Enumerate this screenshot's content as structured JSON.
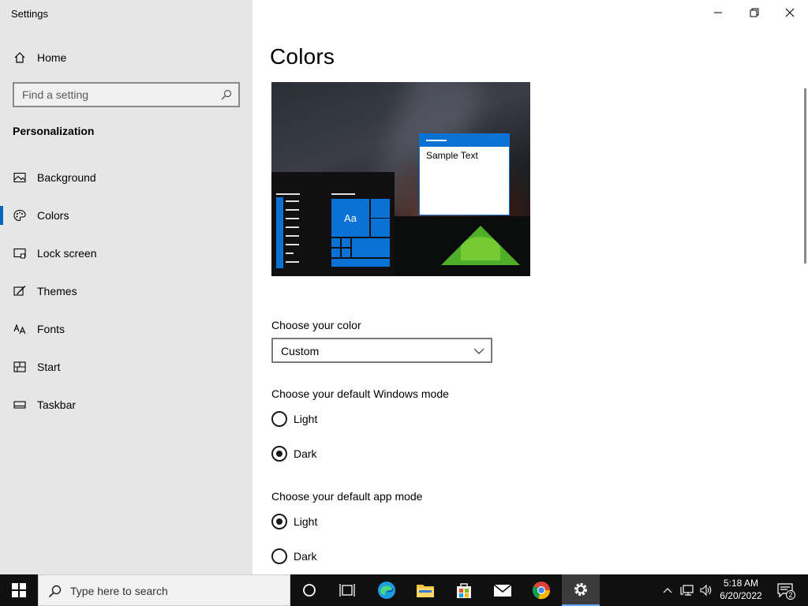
{
  "window": {
    "title": "Settings"
  },
  "sidebar": {
    "home_label": "Home",
    "search_placeholder": "Find a setting",
    "section_title": "Personalization",
    "items": [
      {
        "label": "Background",
        "icon": "picture-icon"
      },
      {
        "label": "Colors",
        "icon": "palette-icon",
        "active": true
      },
      {
        "label": "Lock screen",
        "icon": "lock-screen-icon"
      },
      {
        "label": "Themes",
        "icon": "brush-icon"
      },
      {
        "label": "Fonts",
        "icon": "fonts-icon"
      },
      {
        "label": "Start",
        "icon": "start-icon"
      },
      {
        "label": "Taskbar",
        "icon": "taskbar-icon"
      }
    ]
  },
  "main": {
    "title": "Colors",
    "preview": {
      "sample_text": "Sample Text",
      "tile_text": "Aa"
    },
    "choose_color": {
      "label": "Choose your color",
      "value": "Custom"
    },
    "windows_mode": {
      "label": "Choose your default Windows mode",
      "options": [
        "Light",
        "Dark"
      ],
      "selected": "Dark"
    },
    "app_mode": {
      "label": "Choose your default app mode",
      "options": [
        "Light",
        "Dark"
      ],
      "selected": "Light"
    }
  },
  "taskbar": {
    "search_placeholder": "Type here to search",
    "time": "5:18 AM",
    "date": "6/20/2022",
    "notification_count": "2"
  },
  "colors": {
    "accent": "#0a72d4",
    "sidebar_bg": "#e6e6e6",
    "taskbar_bg": "#101010"
  }
}
